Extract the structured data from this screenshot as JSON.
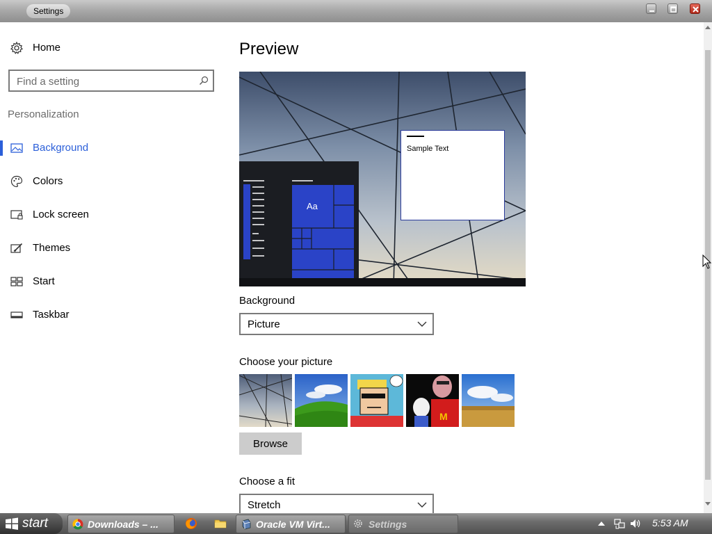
{
  "window": {
    "title": "Settings"
  },
  "sidebar": {
    "home_label": "Home",
    "search_placeholder": "Find a setting",
    "section_title": "Personalization",
    "items": [
      {
        "label": "Background",
        "icon": "image-icon",
        "active": true
      },
      {
        "label": "Colors",
        "icon": "palette-icon",
        "active": false
      },
      {
        "label": "Lock screen",
        "icon": "lock-screen-icon",
        "active": false
      },
      {
        "label": "Themes",
        "icon": "brush-icon",
        "active": false
      },
      {
        "label": "Start",
        "icon": "start-tiles-icon",
        "active": false
      },
      {
        "label": "Taskbar",
        "icon": "taskbar-icon",
        "active": false
      }
    ],
    "accent_color": "#2b5fd9"
  },
  "main": {
    "preview_title": "Preview",
    "preview": {
      "sample_text": "Sample Text",
      "tile_text": "Aa"
    },
    "background_label": "Background",
    "background_value": "Picture",
    "choose_picture_label": "Choose your picture",
    "thumbnails": [
      "glass-wall-sky",
      "green-hill-blue-sky",
      "cartoon-man-sunglasses",
      "cartoon-mcdonalds",
      "wheat-field-clouds"
    ],
    "browse_label": "Browse",
    "fit_label": "Choose a fit",
    "fit_value": "Stretch"
  },
  "taskbar": {
    "start_label": "start",
    "tasks": [
      {
        "label": "Downloads – ...",
        "icon": "chrome-icon"
      },
      {
        "label": "Oracle VM Virt...",
        "icon": "virtualbox-icon"
      },
      {
        "label": "Settings",
        "icon": "gear-icon"
      }
    ],
    "quick_launch": [
      "firefox-icon",
      "folder-icon"
    ],
    "clock": "5:53 AM"
  }
}
